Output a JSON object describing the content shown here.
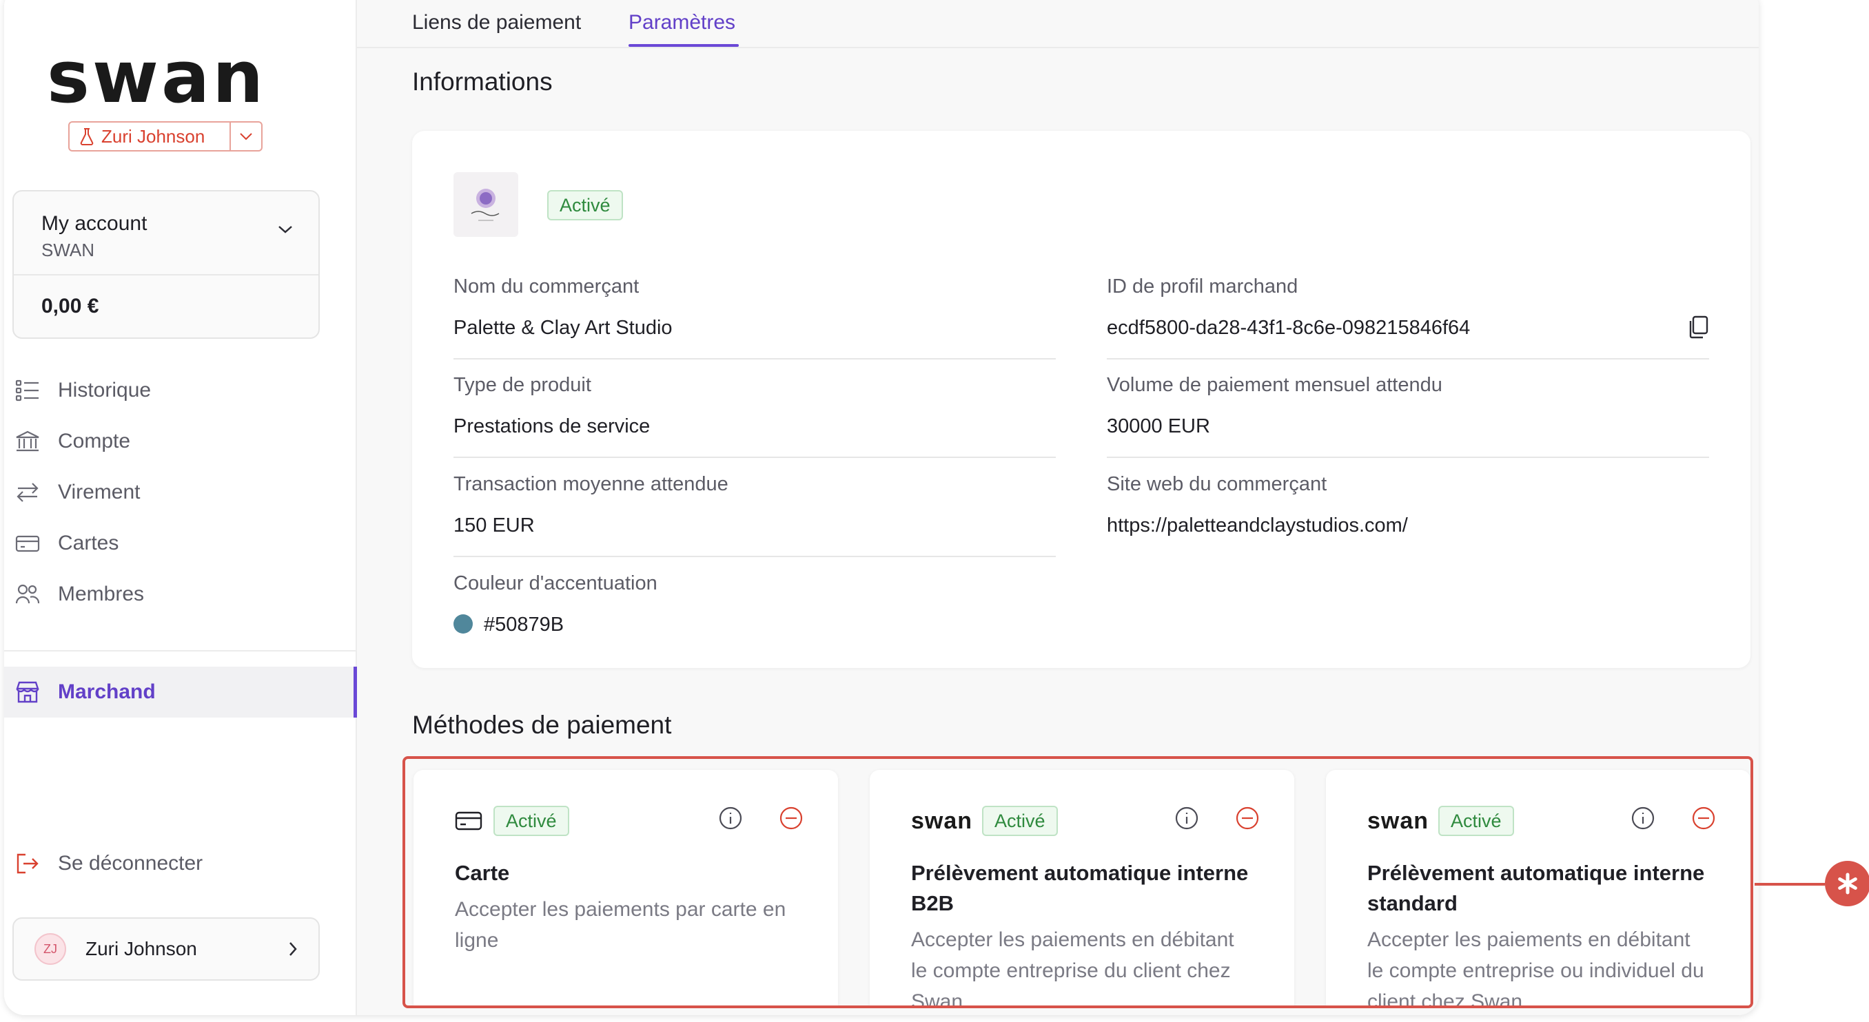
{
  "app": {
    "brand": "swan"
  },
  "env": {
    "user": "Zuri Johnson"
  },
  "account": {
    "name": "My account",
    "org": "SWAN",
    "balance": "0,00 €"
  },
  "nav": {
    "items": [
      {
        "label": "Historique",
        "icon": "history-list-icon"
      },
      {
        "label": "Compte",
        "icon": "bank-icon"
      },
      {
        "label": "Virement",
        "icon": "transfer-arrows-icon"
      },
      {
        "label": "Cartes",
        "icon": "credit-card-icon"
      },
      {
        "label": "Membres",
        "icon": "people-icon"
      }
    ],
    "active": {
      "label": "Marchand",
      "icon": "store-icon"
    },
    "logout": "Se déconnecter"
  },
  "user": {
    "initials": "ZJ",
    "name": "Zuri Johnson"
  },
  "tabs": {
    "links": "Liens de paiement",
    "settings": "Paramètres"
  },
  "info": {
    "title": "Informations",
    "status": "Activé",
    "merchant_name_label": "Nom du commerçant",
    "merchant_name": "Palette & Clay Art Studio",
    "profile_id_label": "ID de profil marchand",
    "profile_id": "ecdf5800-da28-43f1-8c6e-098215846f64",
    "product_type_label": "Type de produit",
    "product_type": "Prestations de service",
    "monthly_volume_label": "Volume de paiement mensuel attendu",
    "monthly_volume": "30000 EUR",
    "avg_tx_label": "Transaction moyenne attendue",
    "avg_tx": "150 EUR",
    "website_label": "Site web du commerçant",
    "website": "https://paletteandclaystudios.com/",
    "accent_label": "Couleur d'accentuation",
    "accent_value": "#50879B",
    "accent_color": "#50879B"
  },
  "methods": {
    "title": "Méthodes de paiement",
    "cards": [
      {
        "badge": "Activé",
        "title": "Carte",
        "desc": "Accepter les paiements par carte en ligne"
      },
      {
        "logo": "swan",
        "badge": "Activé",
        "title": "Prélèvement automatique interne B2B",
        "desc": "Accepter les paiements en débitant le compte entreprise du client chez Swan"
      },
      {
        "logo": "swan",
        "badge": "Activé",
        "title": "Prélèvement automatique interne standard",
        "desc": "Accepter les paiements en débitant le compte entreprise ou individuel du client chez Swan"
      }
    ]
  },
  "colors": {
    "accent": "#6240c8",
    "active_badge": "#2f8a3e",
    "annotation": "#d7534a"
  }
}
